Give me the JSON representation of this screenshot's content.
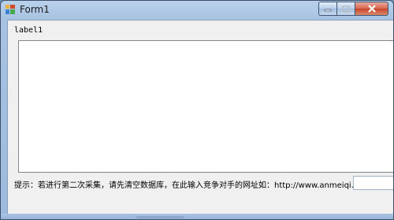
{
  "window": {
    "title": "Form1"
  },
  "titlebar": {
    "minimize_icon": "minimize-icon",
    "maximize_icon": "maximize-icon",
    "close_icon": "close-icon"
  },
  "form": {
    "label1": "label1",
    "hint": "提示：若进行第二次采集，请先清空数据库，在此输入竞争对手的网址如：http://www.anmeiqi.com",
    "url_value": ""
  },
  "colors": {
    "title_bar": "#b9d1ea",
    "client_bg": "#f0f0f0",
    "close_button": "#c8452a"
  }
}
